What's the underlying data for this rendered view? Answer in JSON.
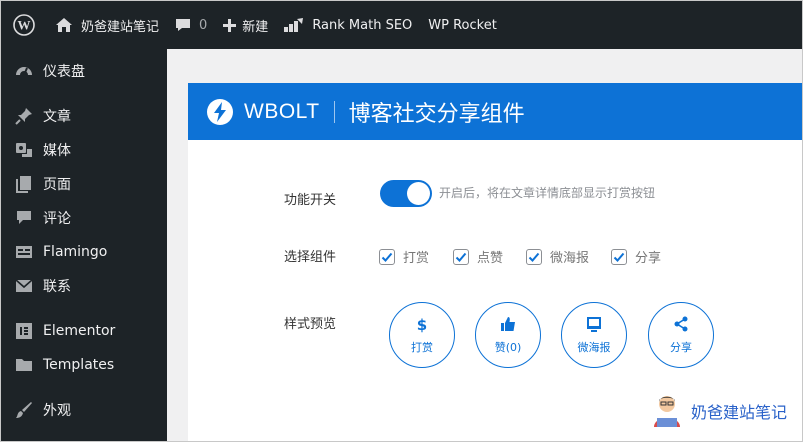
{
  "adminbar": {
    "site_name": "奶爸建站笔记",
    "comments_count": "0",
    "new_label": "新建",
    "rankmath_label": "Rank Math SEO",
    "wprocket_label": "WP Rocket"
  },
  "sidebar": {
    "items": [
      {
        "label": "仪表盘",
        "icon": "dashboard-icon"
      },
      {
        "label": "文章",
        "icon": "pin-icon"
      },
      {
        "label": "媒体",
        "icon": "media-icon"
      },
      {
        "label": "页面",
        "icon": "pages-icon"
      },
      {
        "label": "评论",
        "icon": "comment-icon"
      },
      {
        "label": "Flamingo",
        "icon": "flamingo-icon"
      },
      {
        "label": "联系",
        "icon": "mail-icon"
      },
      {
        "label": "Elementor",
        "icon": "elementor-icon"
      },
      {
        "label": "Templates",
        "icon": "folder-icon"
      },
      {
        "label": "外观",
        "icon": "brush-icon"
      }
    ]
  },
  "plugin": {
    "brand": "WBOLT",
    "title": "博客社交分享组件",
    "switch_label": "功能开关",
    "switch_on": true,
    "switch_desc": "开启后，将在文章详情底部显示打赏按钮",
    "components_label": "选择组件",
    "components": [
      {
        "label": "打赏",
        "checked": true
      },
      {
        "label": "点赞",
        "checked": true
      },
      {
        "label": "微海报",
        "checked": true
      },
      {
        "label": "分享",
        "checked": true
      }
    ],
    "preview_label": "样式预览",
    "preview_buttons": [
      {
        "label": "打赏",
        "icon": "dollar-icon"
      },
      {
        "label": "赞(0)",
        "icon": "thumbs-up-icon"
      },
      {
        "label": "微海报",
        "icon": "poster-icon"
      },
      {
        "label": "分享",
        "icon": "share-icon"
      }
    ]
  },
  "watermark": {
    "text": "奶爸建站笔记"
  },
  "colors": {
    "admin_bg": "#1d2327",
    "accent": "#0d72d6",
    "page_bg": "#f0f0f1"
  }
}
